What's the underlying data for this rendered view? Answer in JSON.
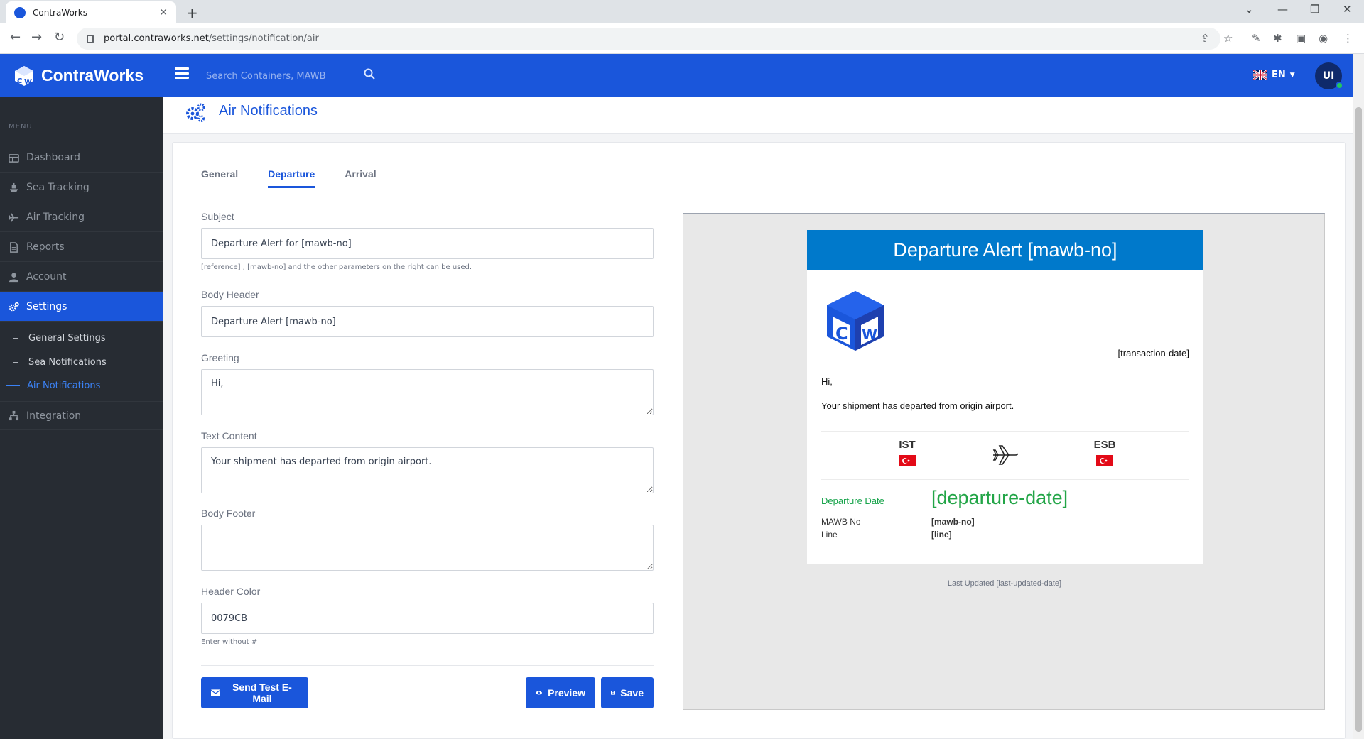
{
  "browser": {
    "tab_title": "ContraWorks",
    "url_host": "portal.contraworks.net",
    "url_path": "/settings/notification/air"
  },
  "header": {
    "brand": "ContraWorks",
    "search_placeholder": "Search Containers, MAWB",
    "language": "EN",
    "avatar_initials": "UI"
  },
  "sidebar": {
    "caption": "MENU",
    "items": [
      {
        "label": "Dashboard",
        "icon": "dashboard-icon"
      },
      {
        "label": "Sea Tracking",
        "icon": "ship-icon"
      },
      {
        "label": "Air Tracking",
        "icon": "plane-icon"
      },
      {
        "label": "Reports",
        "icon": "report-icon"
      },
      {
        "label": "Account",
        "icon": "user-icon"
      },
      {
        "label": "Settings",
        "icon": "gears-icon"
      },
      {
        "label": "Integration",
        "icon": "sitemap-icon"
      }
    ],
    "sub_items": [
      {
        "label": "General Settings"
      },
      {
        "label": "Sea Notifications"
      },
      {
        "label": "Air Notifications"
      }
    ]
  },
  "page": {
    "title": "Air Notifications",
    "tabs": [
      {
        "label": "General"
      },
      {
        "label": "Departure"
      },
      {
        "label": "Arrival"
      }
    ]
  },
  "form": {
    "subject_label": "Subject",
    "subject_value": "Departure Alert for [mawb-no]",
    "subject_help": "[reference] , [mawb-no] and the other parameters on the right can be used.",
    "body_header_label": "Body Header",
    "body_header_value": "Departure Alert [mawb-no]",
    "greeting_label": "Greeting",
    "greeting_value": "Hi,",
    "text_content_label": "Text Content",
    "text_content_value": "Your shipment has departed from origin airport.",
    "body_footer_label": "Body Footer",
    "body_footer_value": "",
    "header_color_label": "Header Color",
    "header_color_value": "0079CB",
    "header_color_help": "Enter without #",
    "send_test_label": "Send Test E-Mail",
    "preview_label": "Preview",
    "save_label": "Save"
  },
  "preview": {
    "header_color": "#0079CB",
    "header": "Departure Alert [mawb-no]",
    "transaction_date": "[transaction-date]",
    "greeting": "Hi,",
    "text": "Your shipment has departed from origin airport.",
    "origin": "IST",
    "destination": "ESB",
    "departure_date_label": "Departure Date",
    "departure_date_value": "[departure-date]",
    "mawb_label": "MAWB No",
    "mawb_value": "[mawb-no]",
    "line_label": "Line",
    "line_value": "[line]",
    "last_updated": "Last Updated [last-updated-date]"
  },
  "colors": {
    "primary": "#1a56db",
    "sidebar_bg": "#272c33",
    "departure_green": "#22a547"
  }
}
